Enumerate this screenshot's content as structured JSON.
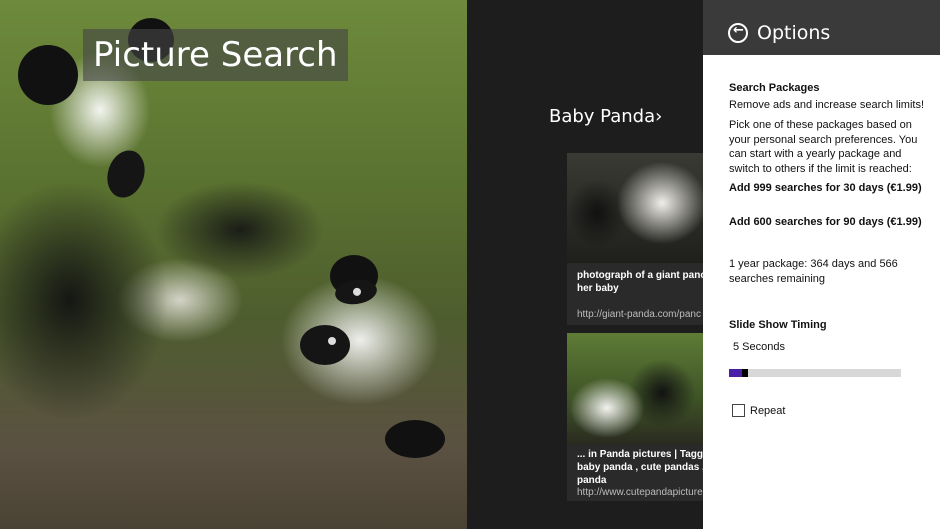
{
  "hero": {
    "title": "Picture Search"
  },
  "group": {
    "label": "Baby Panda",
    "chevron": "›"
  },
  "cards": [
    {
      "caption_lines": [
        "photograph of a giant panc",
        "her baby"
      ],
      "url": "http://giant-panda.com/panc"
    },
    {
      "caption_lines": [
        "... in Panda pictures | Tagge",
        "baby panda , cute pandas ,",
        "panda"
      ],
      "url": "http://www.cutepandapicture"
    }
  ],
  "options": {
    "back_icon": "back-arrow-icon",
    "title": "Options",
    "search_packages": {
      "heading": "Search Packages",
      "subtitle": "Remove ads and increase search limits!",
      "description_lines": [
        "Pick one of these packages based on",
        "your personal search preferences. You",
        "can start with a yearly package and",
        "switch to others if the limit is reached:"
      ],
      "package_1": "Add 999 searches for 30 days (€1.99)",
      "package_2": "Add 600 searches for 90 days (€1.99)",
      "status_lines": [
        "1 year package: 364 days and 566",
        "searches remaining"
      ]
    },
    "slideshow": {
      "heading": "Slide Show Timing",
      "value": "5 Seconds",
      "fraction": 0.11,
      "fill_color": "#4a1fa8"
    },
    "repeat": {
      "label": "Repeat",
      "checked": false
    }
  }
}
